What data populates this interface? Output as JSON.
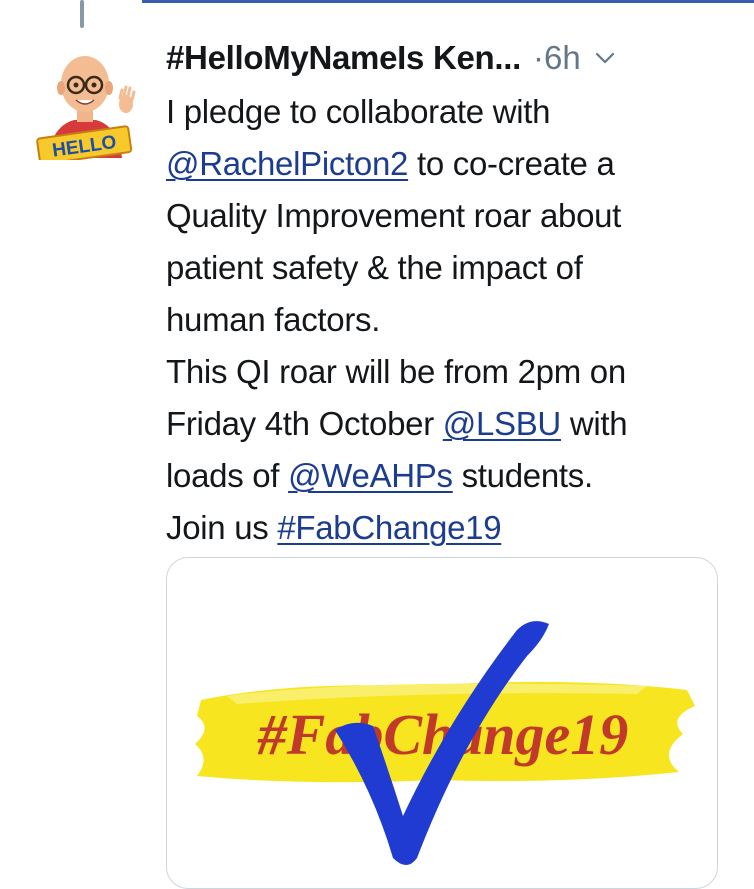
{
  "tweet": {
    "display_name": "#HelloMyNameIs Ken...",
    "separator": "·",
    "time": "6h",
    "avatar_text": "HELLO",
    "body": {
      "l1": "I pledge to collaborate with",
      "mention_rachel": "@RachelPicton2",
      "l2_rest": " to co-create a",
      "l3": "Quality Improvement roar about",
      "l4": "patient safety & the impact of",
      "l5": "human factors.",
      "l6": "This QI roar will be from 2pm on",
      "l7_start": "Friday 4th October ",
      "mention_lsbu": "@LSBU",
      "l7_rest": " with",
      "l8_start": "loads of ",
      "mention_weahps": "@WeAHPs",
      "l8_rest": " students.",
      "l9_start": "Join us ",
      "hashtag": "#FabChange19"
    },
    "media": {
      "image_text": "#FabChange19",
      "colors": {
        "highlight": "#f6e51f",
        "text": "#c0392b",
        "check": "#1f3bd1"
      }
    }
  },
  "colors": {
    "link": "#1c3d8f",
    "muted": "#657786",
    "accent": "#3b5bb0"
  }
}
